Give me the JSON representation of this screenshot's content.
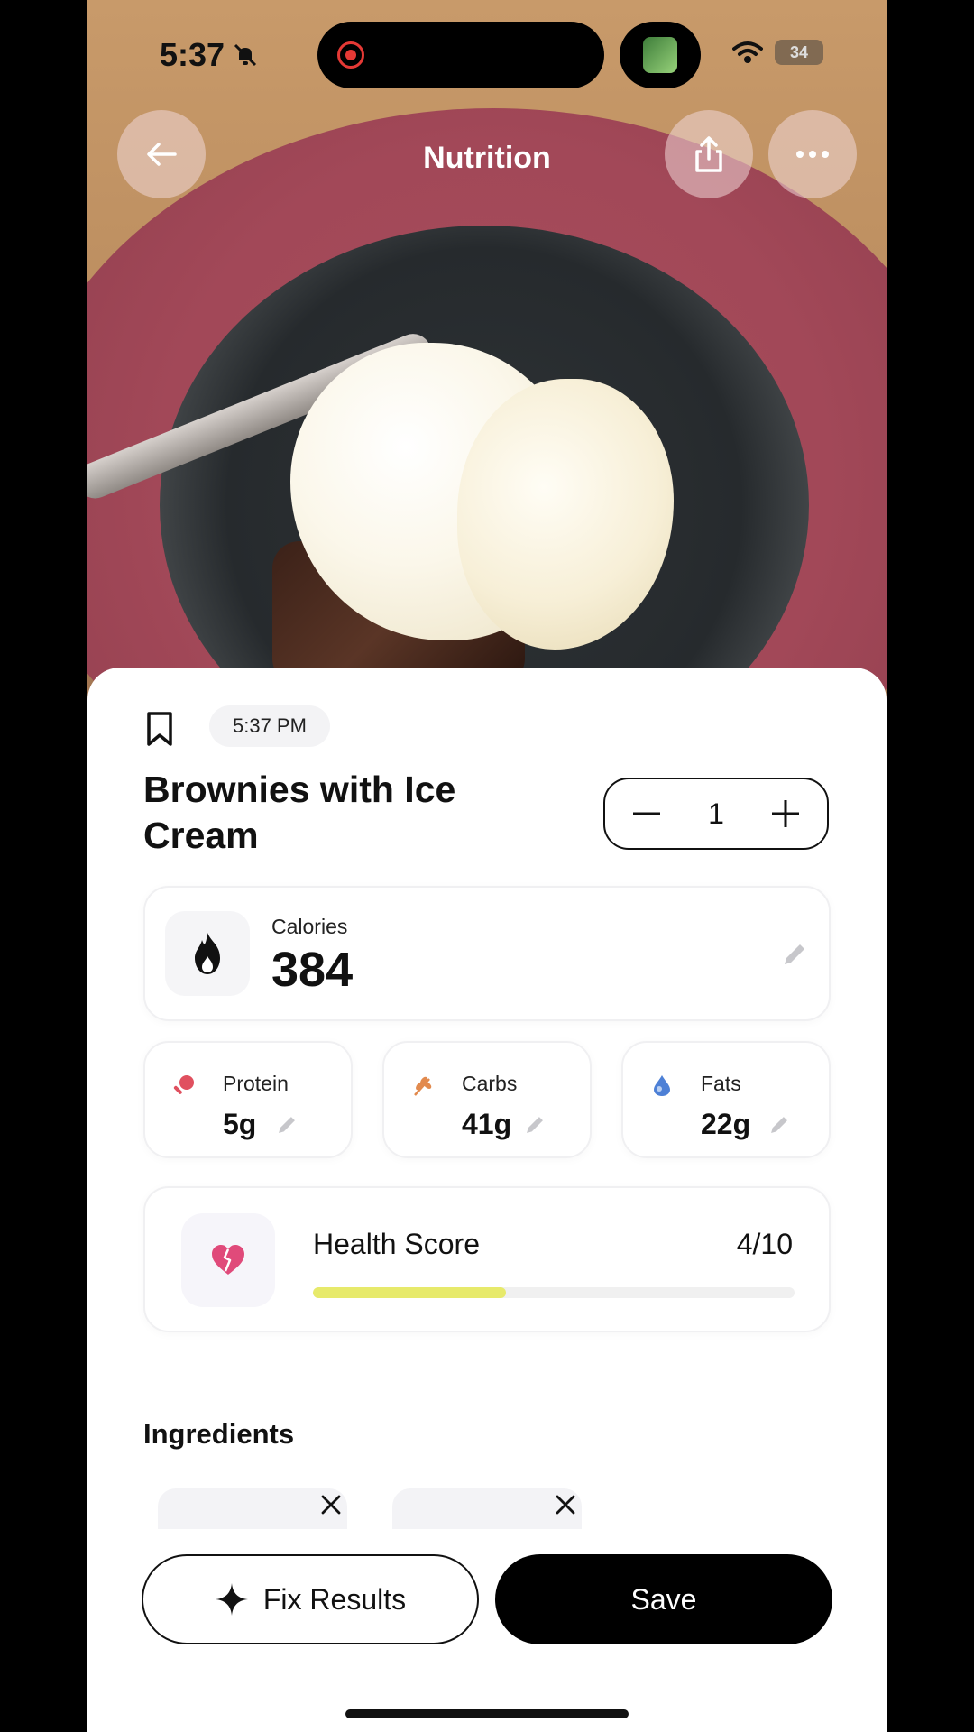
{
  "status_bar": {
    "time": "5:37",
    "battery": "34"
  },
  "header": {
    "title": "Nutrition"
  },
  "meal": {
    "time": "5:37 PM",
    "name": "Brownies with Ice Cream",
    "quantity": "1"
  },
  "calories": {
    "label": "Calories",
    "value": "384"
  },
  "macros": [
    {
      "label": "Protein",
      "value": "5g",
      "color": "#e0505f"
    },
    {
      "label": "Carbs",
      "value": "41g",
      "color": "#e28a4e"
    },
    {
      "label": "Fats",
      "value": "22g",
      "color": "#4d80d6"
    }
  ],
  "health_score": {
    "label": "Health Score",
    "value": "4/10",
    "fraction": 0.4,
    "bar_color": "#e7ea6b"
  },
  "ingredients": {
    "title": "Ingredients"
  },
  "actions": {
    "fix_label": "Fix Results",
    "save_label": "Save"
  }
}
